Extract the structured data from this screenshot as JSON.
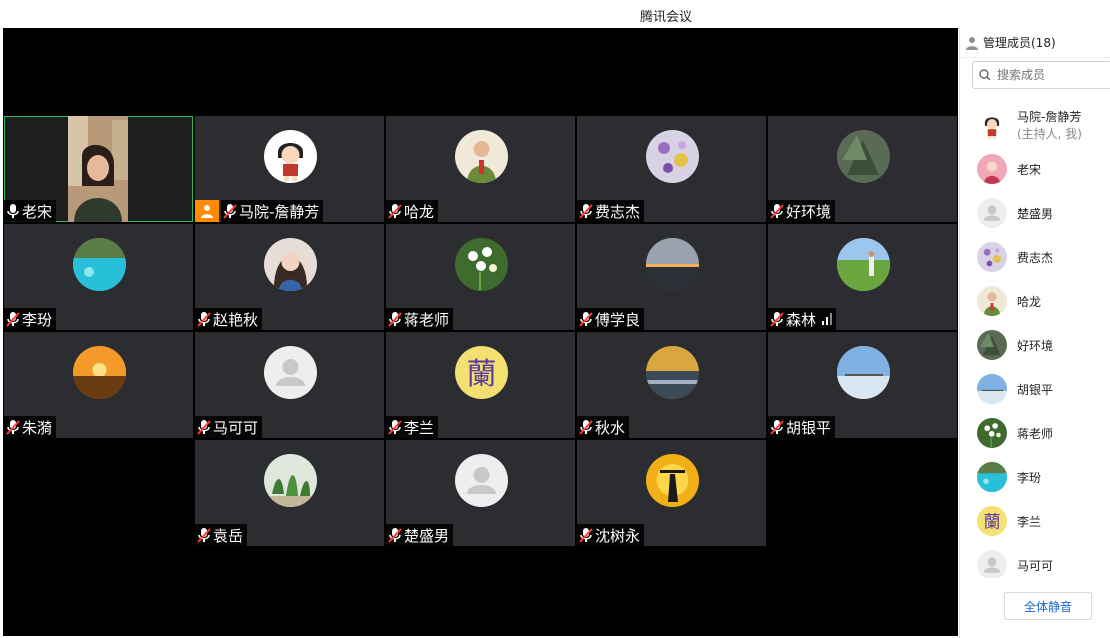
{
  "window": {
    "title": "腾讯会议"
  },
  "colors": {
    "host_badge": "#ff8a00",
    "active_border": "#2fb85a",
    "link": "#1a66d2"
  },
  "tiles": [
    {
      "name": "老宋",
      "mic": "on",
      "active": true,
      "avatar": "camera"
    },
    {
      "name": "马院-詹静芳",
      "mic": "muted",
      "host": true,
      "avatar": "cartoon-girl"
    },
    {
      "name": "哈龙",
      "mic": "muted",
      "avatar": "man-portrait"
    },
    {
      "name": "费志杰",
      "mic": "muted",
      "avatar": "flower-pattern"
    },
    {
      "name": "好环境",
      "mic": "muted",
      "avatar": "tree"
    },
    {
      "name": "李玢",
      "mic": "muted",
      "avatar": "lake"
    },
    {
      "name": "赵艳秋",
      "mic": "muted",
      "avatar": "woman-portrait"
    },
    {
      "name": "蒋老师",
      "mic": "muted",
      "avatar": "white-flowers"
    },
    {
      "name": "傅学良",
      "mic": "muted",
      "avatar": "sunset-sea"
    },
    {
      "name": "森林",
      "mic": "muted",
      "avatar": "field-man",
      "signal": true
    },
    {
      "name": "朱漪",
      "mic": "muted",
      "avatar": "golden-sunset"
    },
    {
      "name": "马可可",
      "mic": "muted",
      "avatar": "default"
    },
    {
      "name": "李兰",
      "mic": "muted",
      "avatar": "orchid-char"
    },
    {
      "name": "秋水",
      "mic": "muted",
      "avatar": "autumn-trees"
    },
    {
      "name": "胡银平",
      "mic": "muted",
      "avatar": "sky-beach"
    },
    {
      "name": "袁岳",
      "mic": "muted",
      "avatar": "plants"
    },
    {
      "name": "楚盛男",
      "mic": "muted",
      "avatar": "default"
    },
    {
      "name": "沈树永",
      "mic": "muted",
      "avatar": "silhouette"
    }
  ],
  "panel": {
    "header": "管理成员(18)",
    "search_placeholder": "搜索成员",
    "members": [
      {
        "name": "马院-詹静芳",
        "sub": "(主持人, 我)",
        "avatar": "cartoon-girl"
      },
      {
        "name": "老宋",
        "avatar": "woman-pink"
      },
      {
        "name": "楚盛男",
        "avatar": "default"
      },
      {
        "name": "费志杰",
        "avatar": "flower-pattern"
      },
      {
        "name": "哈龙",
        "avatar": "man-portrait"
      },
      {
        "name": "好环境",
        "avatar": "tree"
      },
      {
        "name": "胡银平",
        "avatar": "sky-beach"
      },
      {
        "name": "蒋老师",
        "avatar": "white-flowers"
      },
      {
        "name": "李玢",
        "avatar": "lake"
      },
      {
        "name": "李兰",
        "avatar": "orchid-char"
      },
      {
        "name": "马可可",
        "avatar": "default"
      }
    ],
    "mute_all": "全体静音"
  }
}
